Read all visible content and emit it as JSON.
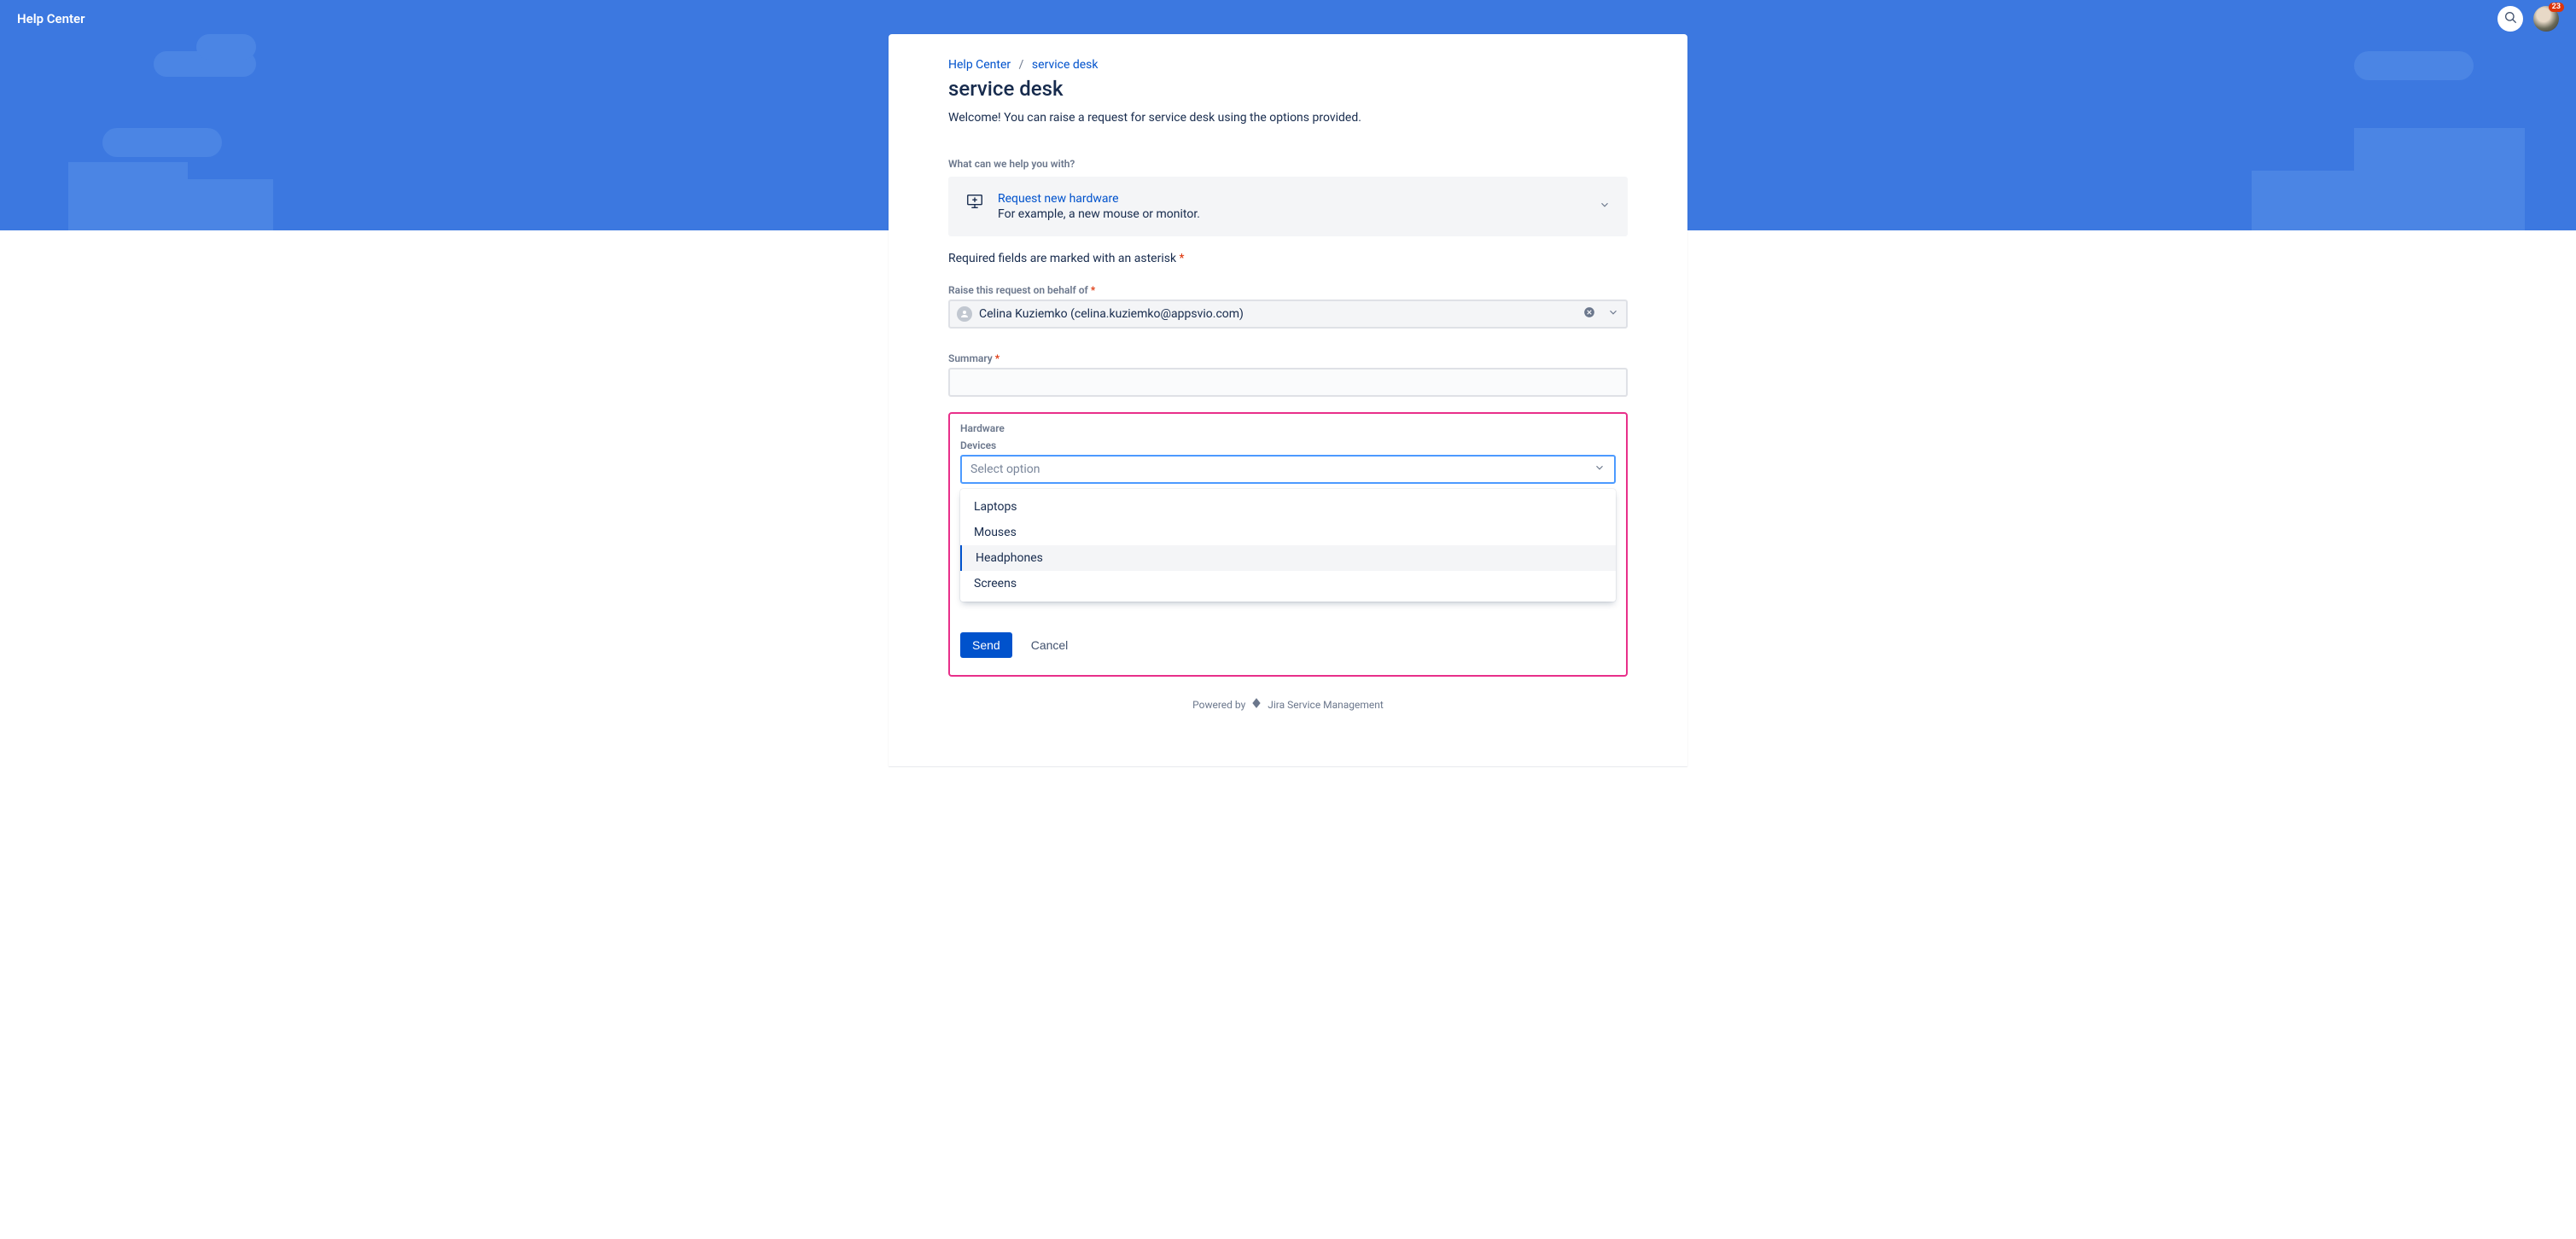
{
  "header": {
    "brand": "Help Center",
    "notification_count": "23"
  },
  "breadcrumbs": {
    "items": [
      {
        "label": "Help Center"
      },
      {
        "label": "service desk"
      }
    ]
  },
  "page": {
    "title": "service desk",
    "intro": "Welcome! You can raise a request for service desk using the options provided.",
    "help_prompt": "What can we help you with?",
    "required_note": "Required fields are marked with an asterisk",
    "asterisk": "*"
  },
  "request_type": {
    "title": "Request new hardware",
    "description": "For example, a new mouse or monitor."
  },
  "fields": {
    "behalf_label": "Raise this request on behalf of",
    "behalf_value": "Celina Kuziemko (celina.kuziemko@appsvio.com)",
    "summary_label": "Summary",
    "summary_value": ""
  },
  "hardware": {
    "section_label": "Hardware",
    "field_label": "Devices",
    "placeholder": "Select option",
    "options": [
      "Laptops",
      "Mouses",
      "Headphones",
      "Screens"
    ],
    "active_index": 2
  },
  "actions": {
    "send": "Send",
    "cancel": "Cancel"
  },
  "footer": {
    "powered_by": "Powered by",
    "product": "Jira Service Management"
  }
}
